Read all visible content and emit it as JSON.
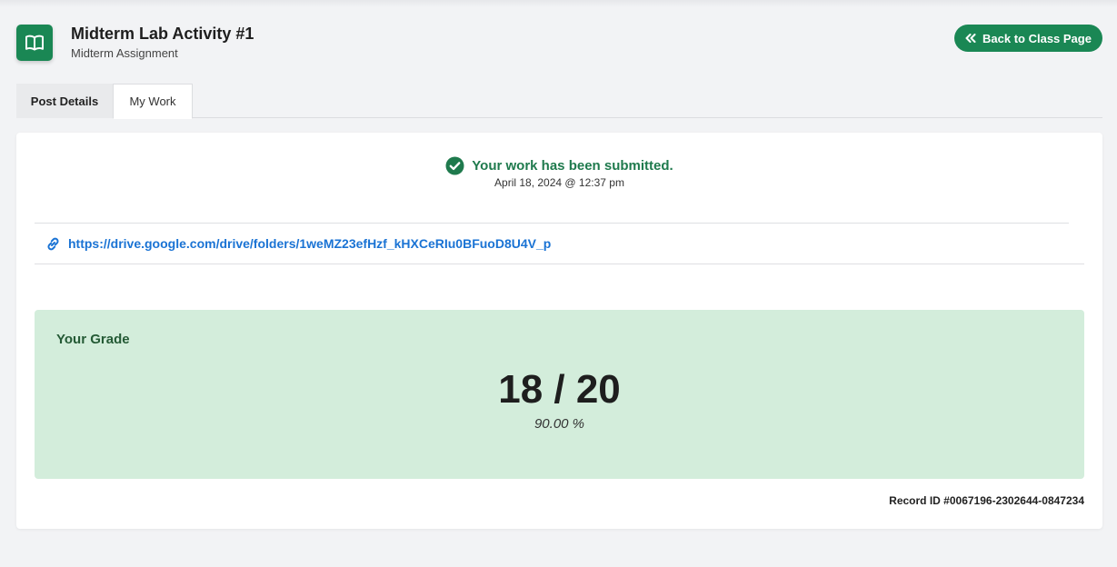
{
  "header": {
    "title": "Midterm Lab Activity #1",
    "subtitle": "Midterm Assignment",
    "back_label": "Back to Class Page"
  },
  "tabs": [
    {
      "label": "Post Details"
    },
    {
      "label": "My Work",
      "active": true
    }
  ],
  "submission": {
    "status": "Your work has been submitted.",
    "date": "April 18, 2024 @ 12:37 pm",
    "link": "https://drive.google.com/drive/folders/1weMZ23efHzf_kHXCeRIu0BFuoD8U4V_p"
  },
  "grade": {
    "label": "Your Grade",
    "score": "18 / 20",
    "percent": "90.00 %"
  },
  "record_id": "Record ID #0067196-2302644-0847234",
  "colors": {
    "brand_green": "#1a8754",
    "success_text": "#1f7a4d",
    "grade_bg": "#d3eddb",
    "link_blue": "#1a73d4"
  },
  "icons": {
    "badge": "open-book-icon",
    "back": "double-chevron-left-icon",
    "status": "check-circle-icon",
    "link": "link-icon"
  }
}
